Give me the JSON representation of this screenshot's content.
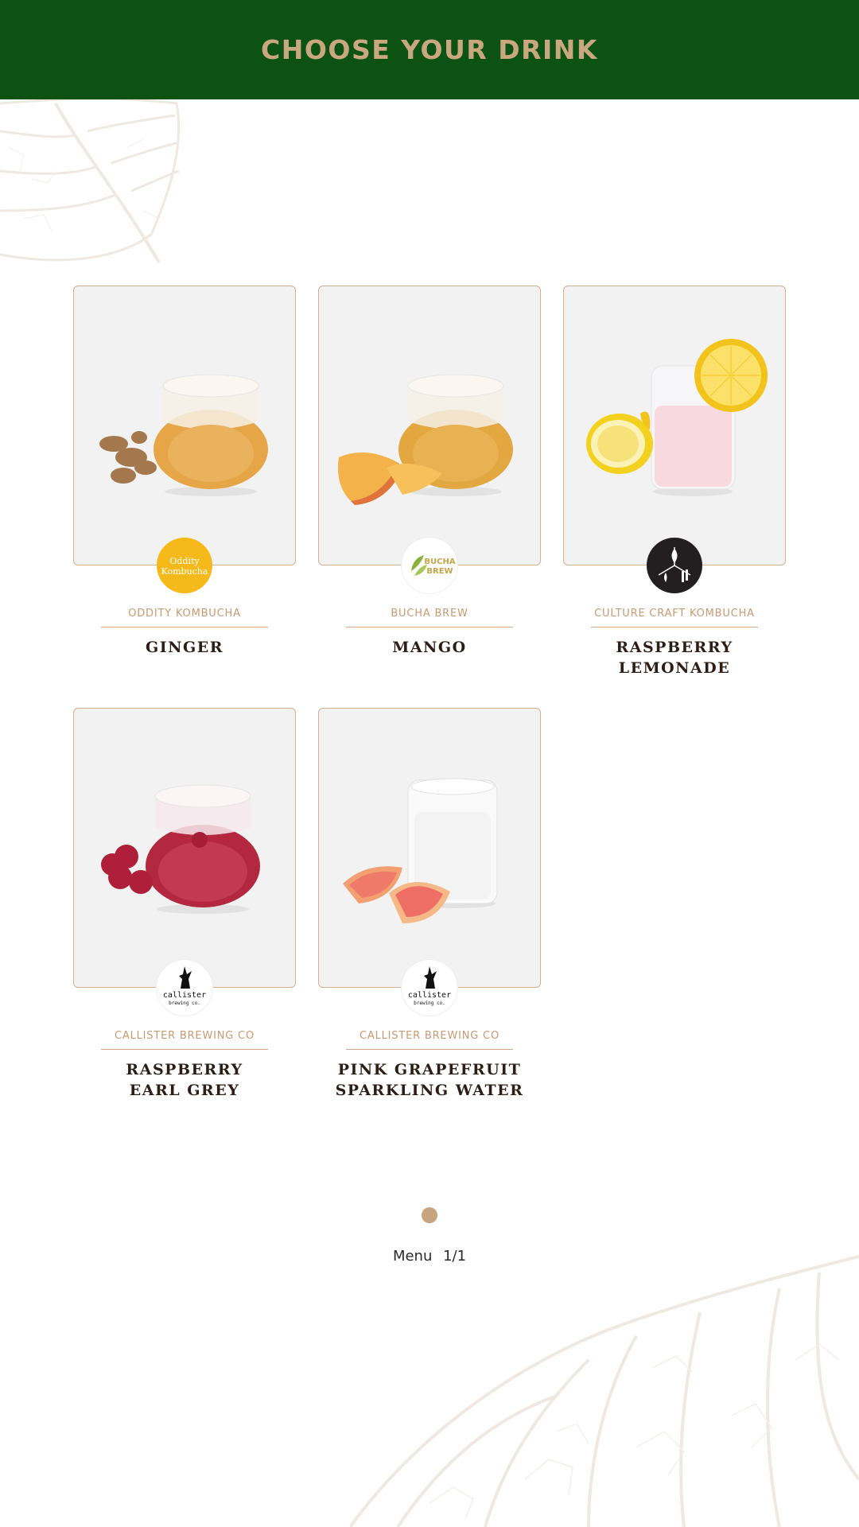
{
  "header": {
    "title": "CHOOSE YOUR DRINK"
  },
  "drinks": [
    {
      "brand": "ODDITY KOMBUCHA",
      "name": "GINGER",
      "logo_text_1": "Oddity",
      "logo_text_2": "Kombucha",
      "logo_color": "#f5b919"
    },
    {
      "brand": "BUCHA BREW",
      "name": "MANGO",
      "logo_text_1": "BUCHA",
      "logo_text_2": "BREW",
      "logo_color": "#8ab13a"
    },
    {
      "brand": "CULTURE CRAFT KOMBUCHA",
      "name": "RASPBERRY\nLEMONADE",
      "logo_color": "#231f20"
    },
    {
      "brand": "CALLISTER BREWING CO",
      "name": "RASPBERRY\nEARL GREY",
      "logo_text_1": "callister",
      "logo_text_2": "brewing co."
    },
    {
      "brand": "CALLISTER BREWING CO",
      "name": "PINK GRAPEFRUIT\nSPARKLING WATER",
      "logo_text_1": "callister",
      "logo_text_2": "brewing co."
    }
  ],
  "pager": {
    "label": "Menu",
    "page": "1/1"
  },
  "colors": {
    "header_bg": "#0c5213",
    "accent": "#c9a880",
    "card_bg": "#f2f2f2"
  }
}
